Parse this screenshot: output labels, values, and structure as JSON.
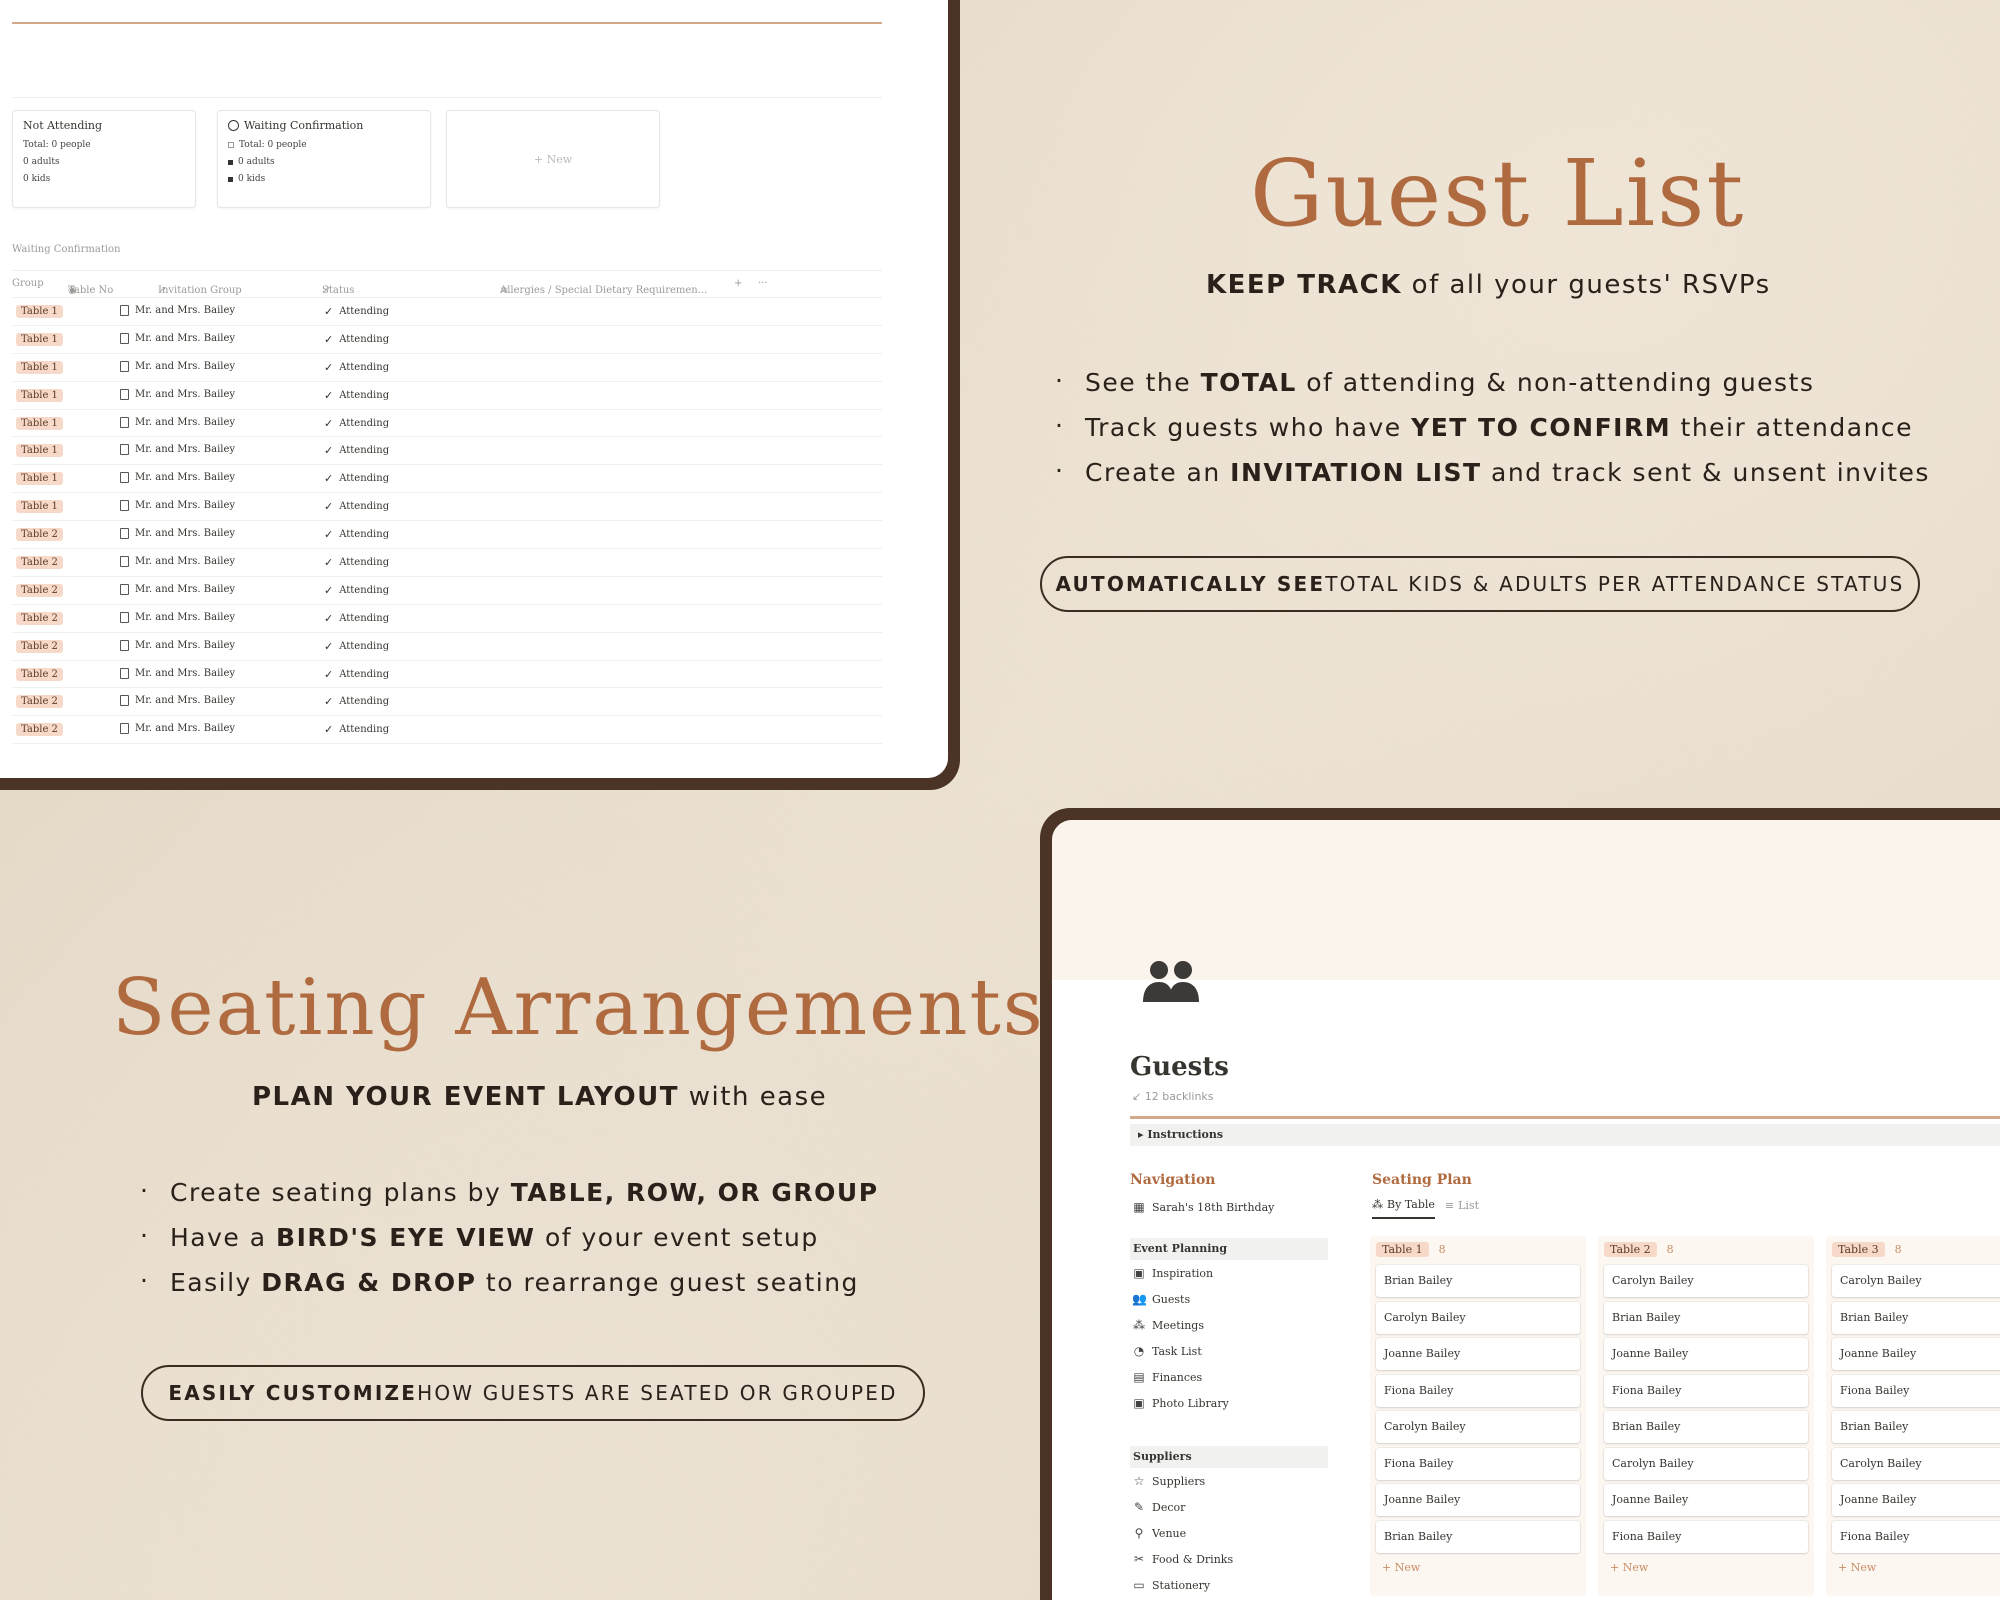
{
  "guest_list": {
    "title": "Guest List",
    "subtitle_bold": "KEEP TRACK",
    "subtitle_rest": " of all your guests' RSVPs",
    "bullets": [
      {
        "pre": "See the ",
        "bold": "TOTAL",
        "post": " of attending & non-attending guests"
      },
      {
        "pre": "Track guests who have ",
        "bold": "YET TO CONFIRM",
        "post": " their attendance"
      },
      {
        "pre": "Create an ",
        "bold": "INVITATION LIST",
        "post": " and track sent & unsent invites"
      }
    ],
    "pill_bold": "AUTOMATICALLY SEE",
    "pill_rest": " TOTAL KIDS & ADULTS PER ATTENDANCE STATUS"
  },
  "seating": {
    "title": "Seating Arrangements",
    "subtitle_bold": "PLAN YOUR EVENT LAYOUT",
    "subtitle_rest": " with ease",
    "bullets": [
      {
        "pre": "Create seating plans by ",
        "bold": "TABLE, ROW, OR GROUP",
        "post": ""
      },
      {
        "pre": "Have a ",
        "bold": "BIRD'S EYE VIEW",
        "post": " of your event setup"
      },
      {
        "pre": "Easily ",
        "bold": "DRAG & DROP",
        "post": " to rearrange guest seating"
      }
    ],
    "pill_bold": "EASILY CUSTOMIZE",
    "pill_rest": " HOW GUESTS ARE SEATED OR GROUPED"
  },
  "top_screen": {
    "cards": {
      "not_attending": {
        "title": "Not Attending",
        "total": "Total: 0 people",
        "adults": "0 adults",
        "kids": "0 kids"
      },
      "waiting": {
        "title": "Waiting Confirmation",
        "total": "Total: 0 people",
        "adults": "0 adults",
        "kids": "0 kids"
      },
      "new": "+ New"
    },
    "section_label": "Waiting Confirmation",
    "columns": {
      "group": "Group",
      "table_no": "Table No",
      "invitation_group": "Invitation Group",
      "status": "Status",
      "allergies": "Allergies / Special Dietary Requiremen...",
      "add": "+",
      "more": "···"
    },
    "rows": [
      {
        "table": "Table 1",
        "invitation": "Mr. and Mrs. Bailey",
        "status": "Attending"
      },
      {
        "table": "Table 1",
        "invitation": "Mr. and Mrs. Bailey",
        "status": "Attending"
      },
      {
        "table": "Table 1",
        "invitation": "Mr. and Mrs. Bailey",
        "status": "Attending"
      },
      {
        "table": "Table 1",
        "invitation": "Mr. and Mrs. Bailey",
        "status": "Attending"
      },
      {
        "table": "Table 1",
        "invitation": "Mr. and Mrs. Bailey",
        "status": "Attending"
      },
      {
        "table": "Table 1",
        "invitation": "Mr. and Mrs. Bailey",
        "status": "Attending"
      },
      {
        "table": "Table 1",
        "invitation": "Mr. and Mrs. Bailey",
        "status": "Attending"
      },
      {
        "table": "Table 1",
        "invitation": "Mr. and Mrs. Bailey",
        "status": "Attending"
      },
      {
        "table": "Table 2",
        "invitation": "Mr. and Mrs. Bailey",
        "status": "Attending"
      },
      {
        "table": "Table 2",
        "invitation": "Mr. and Mrs. Bailey",
        "status": "Attending"
      },
      {
        "table": "Table 2",
        "invitation": "Mr. and Mrs. Bailey",
        "status": "Attending"
      },
      {
        "table": "Table 2",
        "invitation": "Mr. and Mrs. Bailey",
        "status": "Attending"
      },
      {
        "table": "Table 2",
        "invitation": "Mr. and Mrs. Bailey",
        "status": "Attending"
      },
      {
        "table": "Table 2",
        "invitation": "Mr. and Mrs. Bailey",
        "status": "Attending"
      },
      {
        "table": "Table 2",
        "invitation": "Mr. and Mrs. Bailey",
        "status": "Attending"
      },
      {
        "table": "Table 2",
        "invitation": "Mr. and Mrs. Bailey",
        "status": "Attending"
      }
    ]
  },
  "bottom_screen": {
    "page_icon": "people-icon",
    "title": "Guests",
    "backlinks": "↙ 12 backlinks",
    "instructions": "Instructions",
    "navigation": {
      "heading": "Navigation",
      "event": "Sarah's 18th Birthday",
      "groups": [
        {
          "label": "Event Planning",
          "items": [
            {
              "icon": "▣",
              "label": "Inspiration"
            },
            {
              "icon": "👥",
              "label": "Guests"
            },
            {
              "icon": "⁂",
              "label": "Meetings"
            },
            {
              "icon": "◔",
              "label": "Task List"
            },
            {
              "icon": "▤",
              "label": "Finances"
            },
            {
              "icon": "▣",
              "label": "Photo Library"
            }
          ]
        },
        {
          "label": "Suppliers",
          "items": [
            {
              "icon": "☆",
              "label": "Suppliers"
            },
            {
              "icon": "✎",
              "label": "Decor"
            },
            {
              "icon": "⚲",
              "label": "Venue"
            },
            {
              "icon": "✂",
              "label": "Food & Drinks"
            },
            {
              "icon": "▭",
              "label": "Stationery"
            }
          ]
        }
      ]
    },
    "seating_plan": {
      "heading": "Seating Plan",
      "tabs": [
        {
          "icon": "⁂",
          "label": "By Table"
        },
        {
          "icon": "≡",
          "label": "List"
        }
      ],
      "columns": [
        {
          "name": "Table 1",
          "count": "8",
          "guests": [
            "Brian Bailey",
            "Carolyn Bailey",
            "Joanne Bailey",
            "Fiona Bailey",
            "Carolyn Bailey",
            "Fiona Bailey",
            "Joanne Bailey",
            "Brian Bailey"
          ]
        },
        {
          "name": "Table 2",
          "count": "8",
          "guests": [
            "Carolyn Bailey",
            "Brian Bailey",
            "Joanne Bailey",
            "Fiona Bailey",
            "Brian Bailey",
            "Carolyn Bailey",
            "Joanne Bailey",
            "Fiona Bailey"
          ]
        },
        {
          "name": "Table 3",
          "count": "8",
          "guests": [
            "Carolyn Bailey",
            "Brian Bailey",
            "Joanne Bailey",
            "Fiona Bailey",
            "Brian Bailey",
            "Carolyn Bailey",
            "Joanne Bailey",
            "Fiona Bailey"
          ]
        }
      ],
      "new_label": "+ New"
    }
  }
}
